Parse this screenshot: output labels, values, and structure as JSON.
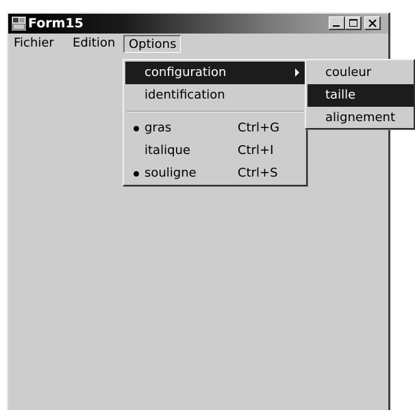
{
  "window": {
    "title": "Form15"
  },
  "menubar": {
    "items": [
      "Fichier",
      "Edition",
      "Options"
    ],
    "open_menu": "Options"
  },
  "options_menu": {
    "items": [
      {
        "label": "configuration",
        "highlighted": true,
        "submenu": true
      },
      {
        "label": "identification"
      },
      {
        "label": "gras",
        "shortcut": "Ctrl+G",
        "checked": true
      },
      {
        "label": "italique",
        "shortcut": "Ctrl+I",
        "checked": false
      },
      {
        "label": "souligne",
        "shortcut": "Ctrl+S",
        "checked": true
      }
    ]
  },
  "configuration_submenu": {
    "items": [
      {
        "label": "couleur"
      },
      {
        "label": "taille",
        "highlighted": true
      },
      {
        "label": "alignement"
      }
    ]
  },
  "colors": {
    "highlight": "#1c1c1c",
    "face": "#cdcdcd"
  },
  "icons": [
    "app-icon",
    "minimize-icon",
    "maximize-icon",
    "close-icon",
    "submenu-arrow-icon"
  ]
}
